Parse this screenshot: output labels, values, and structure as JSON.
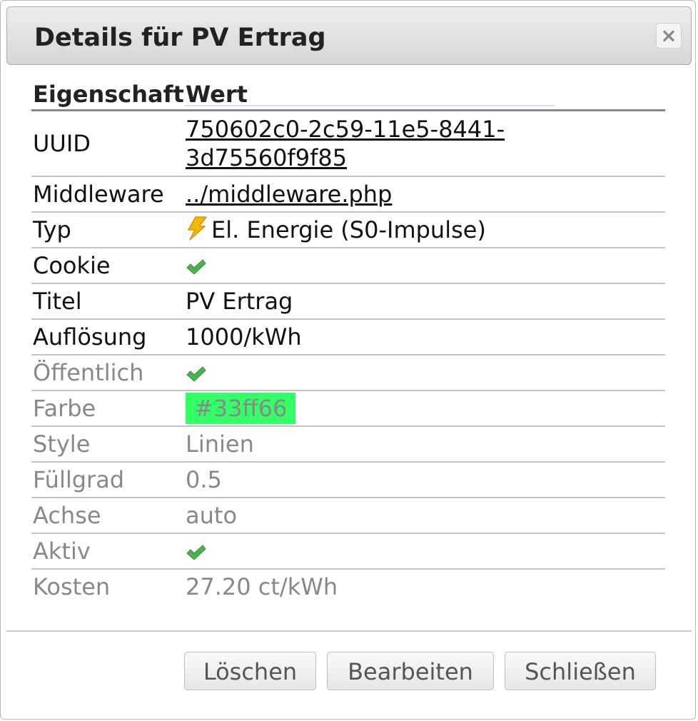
{
  "dialog": {
    "title": "Details für PV Ertrag",
    "close_label": "×"
  },
  "table": {
    "headers": {
      "property": "Eigenschaft",
      "value": "Wert"
    },
    "rows": {
      "uuid": {
        "label": "UUID",
        "value": "750602c0-2c59-11e5-8441-3d75560f9f85"
      },
      "middleware": {
        "label": "Middleware",
        "value": "../middleware.php"
      },
      "type": {
        "label": "Typ",
        "value": "El. Energie (S0-Impulse)",
        "icon": "lightning-icon"
      },
      "cookie": {
        "label": "Cookie",
        "icon": "checkmark-icon"
      },
      "title": {
        "label": "Titel",
        "value": "PV Ertrag"
      },
      "resolution": {
        "label": "Auflösung",
        "value": "1000/kWh"
      },
      "public": {
        "label": "Öffentlich",
        "icon": "checkmark-icon"
      },
      "color": {
        "label": "Farbe",
        "value": "#33ff66"
      },
      "style": {
        "label": "Style",
        "value": "Linien"
      },
      "fill": {
        "label": "Füllgrad",
        "value": "0.5"
      },
      "axis": {
        "label": "Achse",
        "value": "auto"
      },
      "active": {
        "label": "Aktiv",
        "icon": "checkmark-icon"
      },
      "cost": {
        "label": "Kosten",
        "value": "27.20 ct/kWh"
      }
    }
  },
  "buttons": {
    "delete": "Löschen",
    "edit": "Bearbeiten",
    "close": "Schließen"
  },
  "colors": {
    "swatch": "#33ff66",
    "check": "#4caf50",
    "bolt": "#f5b800"
  }
}
